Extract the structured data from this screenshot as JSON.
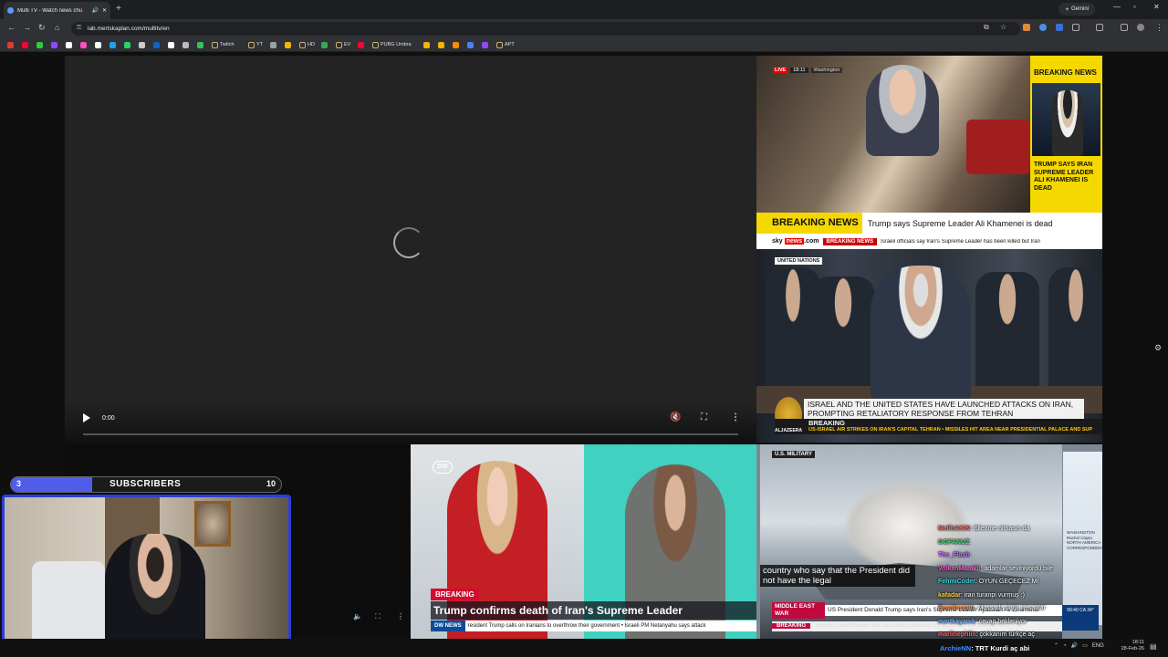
{
  "browser": {
    "tab_title": "Multi TV - Watch news chu",
    "new_tab_icon": "+",
    "gemini_label": "Gemini",
    "url": "lab.mertskaplan.com/multitv/en",
    "bookmarks": [
      {
        "label": "",
        "color": "#e53935"
      },
      {
        "label": "",
        "color": "#ff0033"
      },
      {
        "label": "",
        "color": "#2ecc40"
      },
      {
        "label": "",
        "color": "#9147ff"
      },
      {
        "label": "",
        "color": "#ffffff"
      },
      {
        "label": "",
        "color": "#ff4fb8"
      },
      {
        "label": "",
        "color": "#ffffff"
      },
      {
        "label": "",
        "color": "#1da1f2"
      },
      {
        "label": "",
        "color": "#25d366"
      },
      {
        "label": "",
        "color": "#cccccc"
      },
      {
        "label": "",
        "color": "#0a66c2"
      },
      {
        "label": "",
        "color": "#ffffff"
      },
      {
        "label": "",
        "color": "#bbbbbb"
      },
      {
        "label": "",
        "color": "#35c25e"
      },
      {
        "label": "Twitch",
        "color": "#c9b26b"
      },
      {
        "label": "YT",
        "color": "#c9b26b"
      },
      {
        "label": "",
        "color": "#9aa0a6"
      },
      {
        "label": "",
        "color": "#f4b400"
      },
      {
        "label": "HD",
        "color": "#c9b26b"
      },
      {
        "label": "",
        "color": "#34a853"
      },
      {
        "label": "EV",
        "color": "#c9b26b"
      },
      {
        "label": "",
        "color": "#ff0033"
      },
      {
        "label": "PUBG Umbra",
        "color": "#c9b26b"
      },
      {
        "label": "",
        "color": "#f4b400"
      },
      {
        "label": "",
        "color": "#f4b400"
      },
      {
        "label": "",
        "color": "#ff8c00"
      },
      {
        "label": "",
        "color": "#4285f4"
      },
      {
        "label": "",
        "color": "#9147ff"
      },
      {
        "label": "APT",
        "color": "#c9b26b"
      }
    ]
  },
  "main_player": {
    "time": "0:00"
  },
  "sky": {
    "live": "LIVE",
    "time": "18:11",
    "location": "Washington",
    "side_breaking": "BREAKING NEWS",
    "side_text": "TRUMP SAYS IRAN SUPREME LEADER ALI KHAMENEI IS DEAD",
    "breaking_label": "BREAKING NEWS",
    "headline": "Trump says Supreme Leader Ali Khamenei is dead",
    "logo_sky": "sky",
    "logo_news": "news",
    "logo_com": ".com",
    "ticker_tag": "BREAKING NEWS",
    "ticker": "Israeli officials say Iran's Supreme Leader has been killed but Iran"
  },
  "aljazeera": {
    "tag": "UNITED NATIONS",
    "headline": "ISRAEL AND THE UNITED STATES HAVE LAUNCHED ATTACKS ON IRAN, PROMPTING RETALIATORY RESPONSE FROM TEHRAN",
    "breaking": "BREAKING",
    "ticker": "US-ISRAEL AIR STRIKES ON IRAN'S CAPITAL TEHRAN  •  MISSILES HIT AREA NEAR PRESIDENTIAL PALACE AND SUP",
    "logo": "ALJAZEERA"
  },
  "dw": {
    "logo": "DW",
    "breaking": "BREAKING",
    "headline": "Trump confirms death of Iran's Supreme Leader",
    "ticker_logo": "DW NEWS",
    "ticker": "resident Trump calls on Iranians to overthrow their government  •  Israeli PM Netanyahu says attack"
  },
  "usmil": {
    "tag": "U.S. MILITARY",
    "side_label": "WASHINGTON Rachel Clayto NORTH AMERICA CORRESPONDENT",
    "caption": "country who say that the President did not have the legal",
    "me_tag": "MIDDLE EAST WAR",
    "headline": "US President Donald Trump says Iran's Supreme Leader Ayatollah Ali Khamenei",
    "breaking": "BREAKING",
    "ticker": "Yemen's Houthi leader has described continued US attacks on the Islamic world",
    "clock": "09:40 CA 34°"
  },
  "chat": [
    {
      "user": "MelihAKIN",
      "text": ": Ellenme olmasın da",
      "color": "#ff6a6a"
    },
    {
      "user": "GOFANUZ",
      "text": ":",
      "color": "#3fe07a"
    },
    {
      "user": "The_Flash",
      "text": ":",
      "color": "#c56cff"
    },
    {
      "user": "VolkanMaraklı",
      "text": ": adamlar seviniyordu bile",
      "color": "#ff58d0"
    },
    {
      "user": "FehmiCoder",
      "text": ": OYUN GEÇECEZ Mİ",
      "color": "#3fd7e0"
    },
    {
      "user": "kafadar",
      "text": ": iran turanpi vurmuş :)",
      "color": "#ffd23f"
    },
    {
      "user": "Beanbeanio",
      "text": ": Mossada bağlı hesaplar",
      "color": "#ff8c3f"
    },
    {
      "user": "mertkayanık",
      "text": ": cevap bekleniyor",
      "color": "#7fb7ff"
    },
    {
      "user": "marlinephilo",
      "text": ": çokkanım türkçe aç",
      "color": "#ff6a6a"
    }
  ],
  "chat_last": {
    "user": "ArchieNN",
    "text": ": TRT Kurdi aç abi",
    "color": "#3f8cff"
  },
  "subs": {
    "current": "3",
    "label": "SUBSCRIBERS",
    "goal": "10",
    "progress_fraction": 0.3
  },
  "taskbar": {
    "lang": "ENG",
    "time": "18:11",
    "date": "28-Feb-26"
  }
}
